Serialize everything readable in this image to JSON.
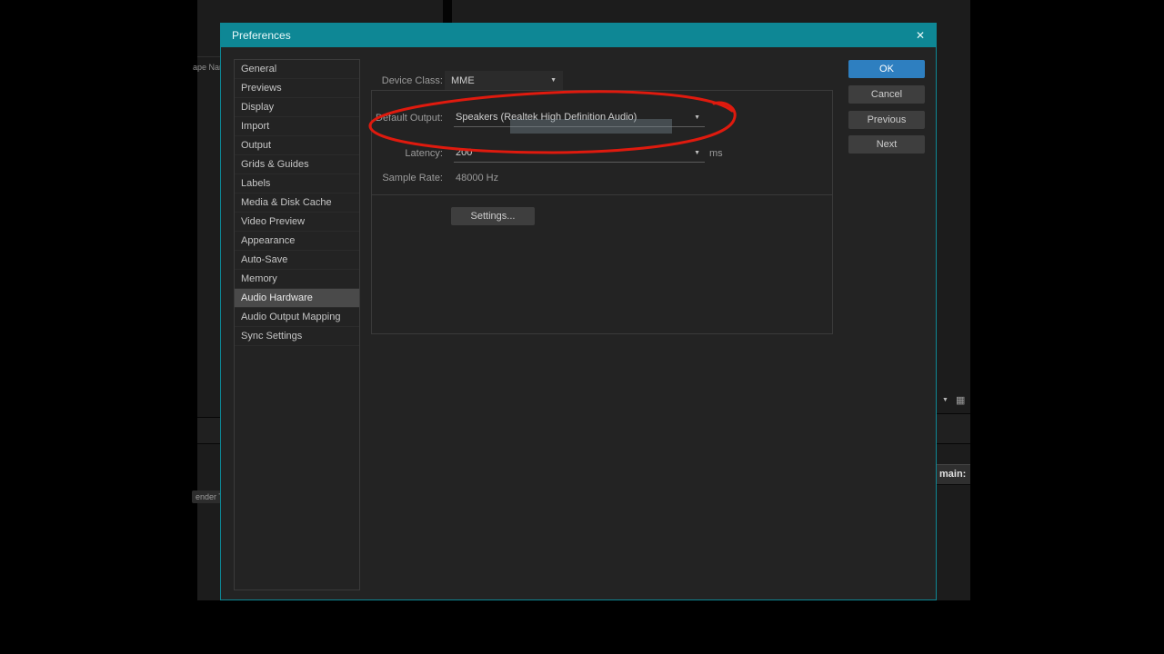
{
  "glyphs": {
    "caret": "▼",
    "close": "✕",
    "panel_icon": "▦"
  },
  "colors": {
    "titlebar_teal": "#0e8795",
    "ok_button_blue": "#2e7fc0",
    "annotation_red": "#df1a0e"
  },
  "background": {
    "left_fragment_top": "ape Nam",
    "left_fragment_bottom": "ender T",
    "right_fragment_label": "main:"
  },
  "dialog": {
    "title": "Preferences",
    "sidebar": {
      "items": [
        "General",
        "Previews",
        "Display",
        "Import",
        "Output",
        "Grids & Guides",
        "Labels",
        "Media & Disk Cache",
        "Video Preview",
        "Appearance",
        "Auto-Save",
        "Memory",
        "Audio Hardware",
        "Audio Output Mapping",
        "Sync Settings"
      ],
      "selected": "Audio Hardware"
    },
    "content": {
      "device_class_label": "Device Class:",
      "device_class_value": "MME",
      "default_output_label": "Default Output:",
      "default_output_value": "Speakers (Realtek High Definition Audio)",
      "latency_label": "Latency:",
      "latency_value": "200",
      "latency_unit": "ms",
      "sample_rate_label": "Sample Rate:",
      "sample_rate_value": "48000 Hz",
      "settings_button_label": "Settings..."
    },
    "buttons": {
      "ok": "OK",
      "cancel": "Cancel",
      "previous": "Previous",
      "next": "Next"
    }
  }
}
